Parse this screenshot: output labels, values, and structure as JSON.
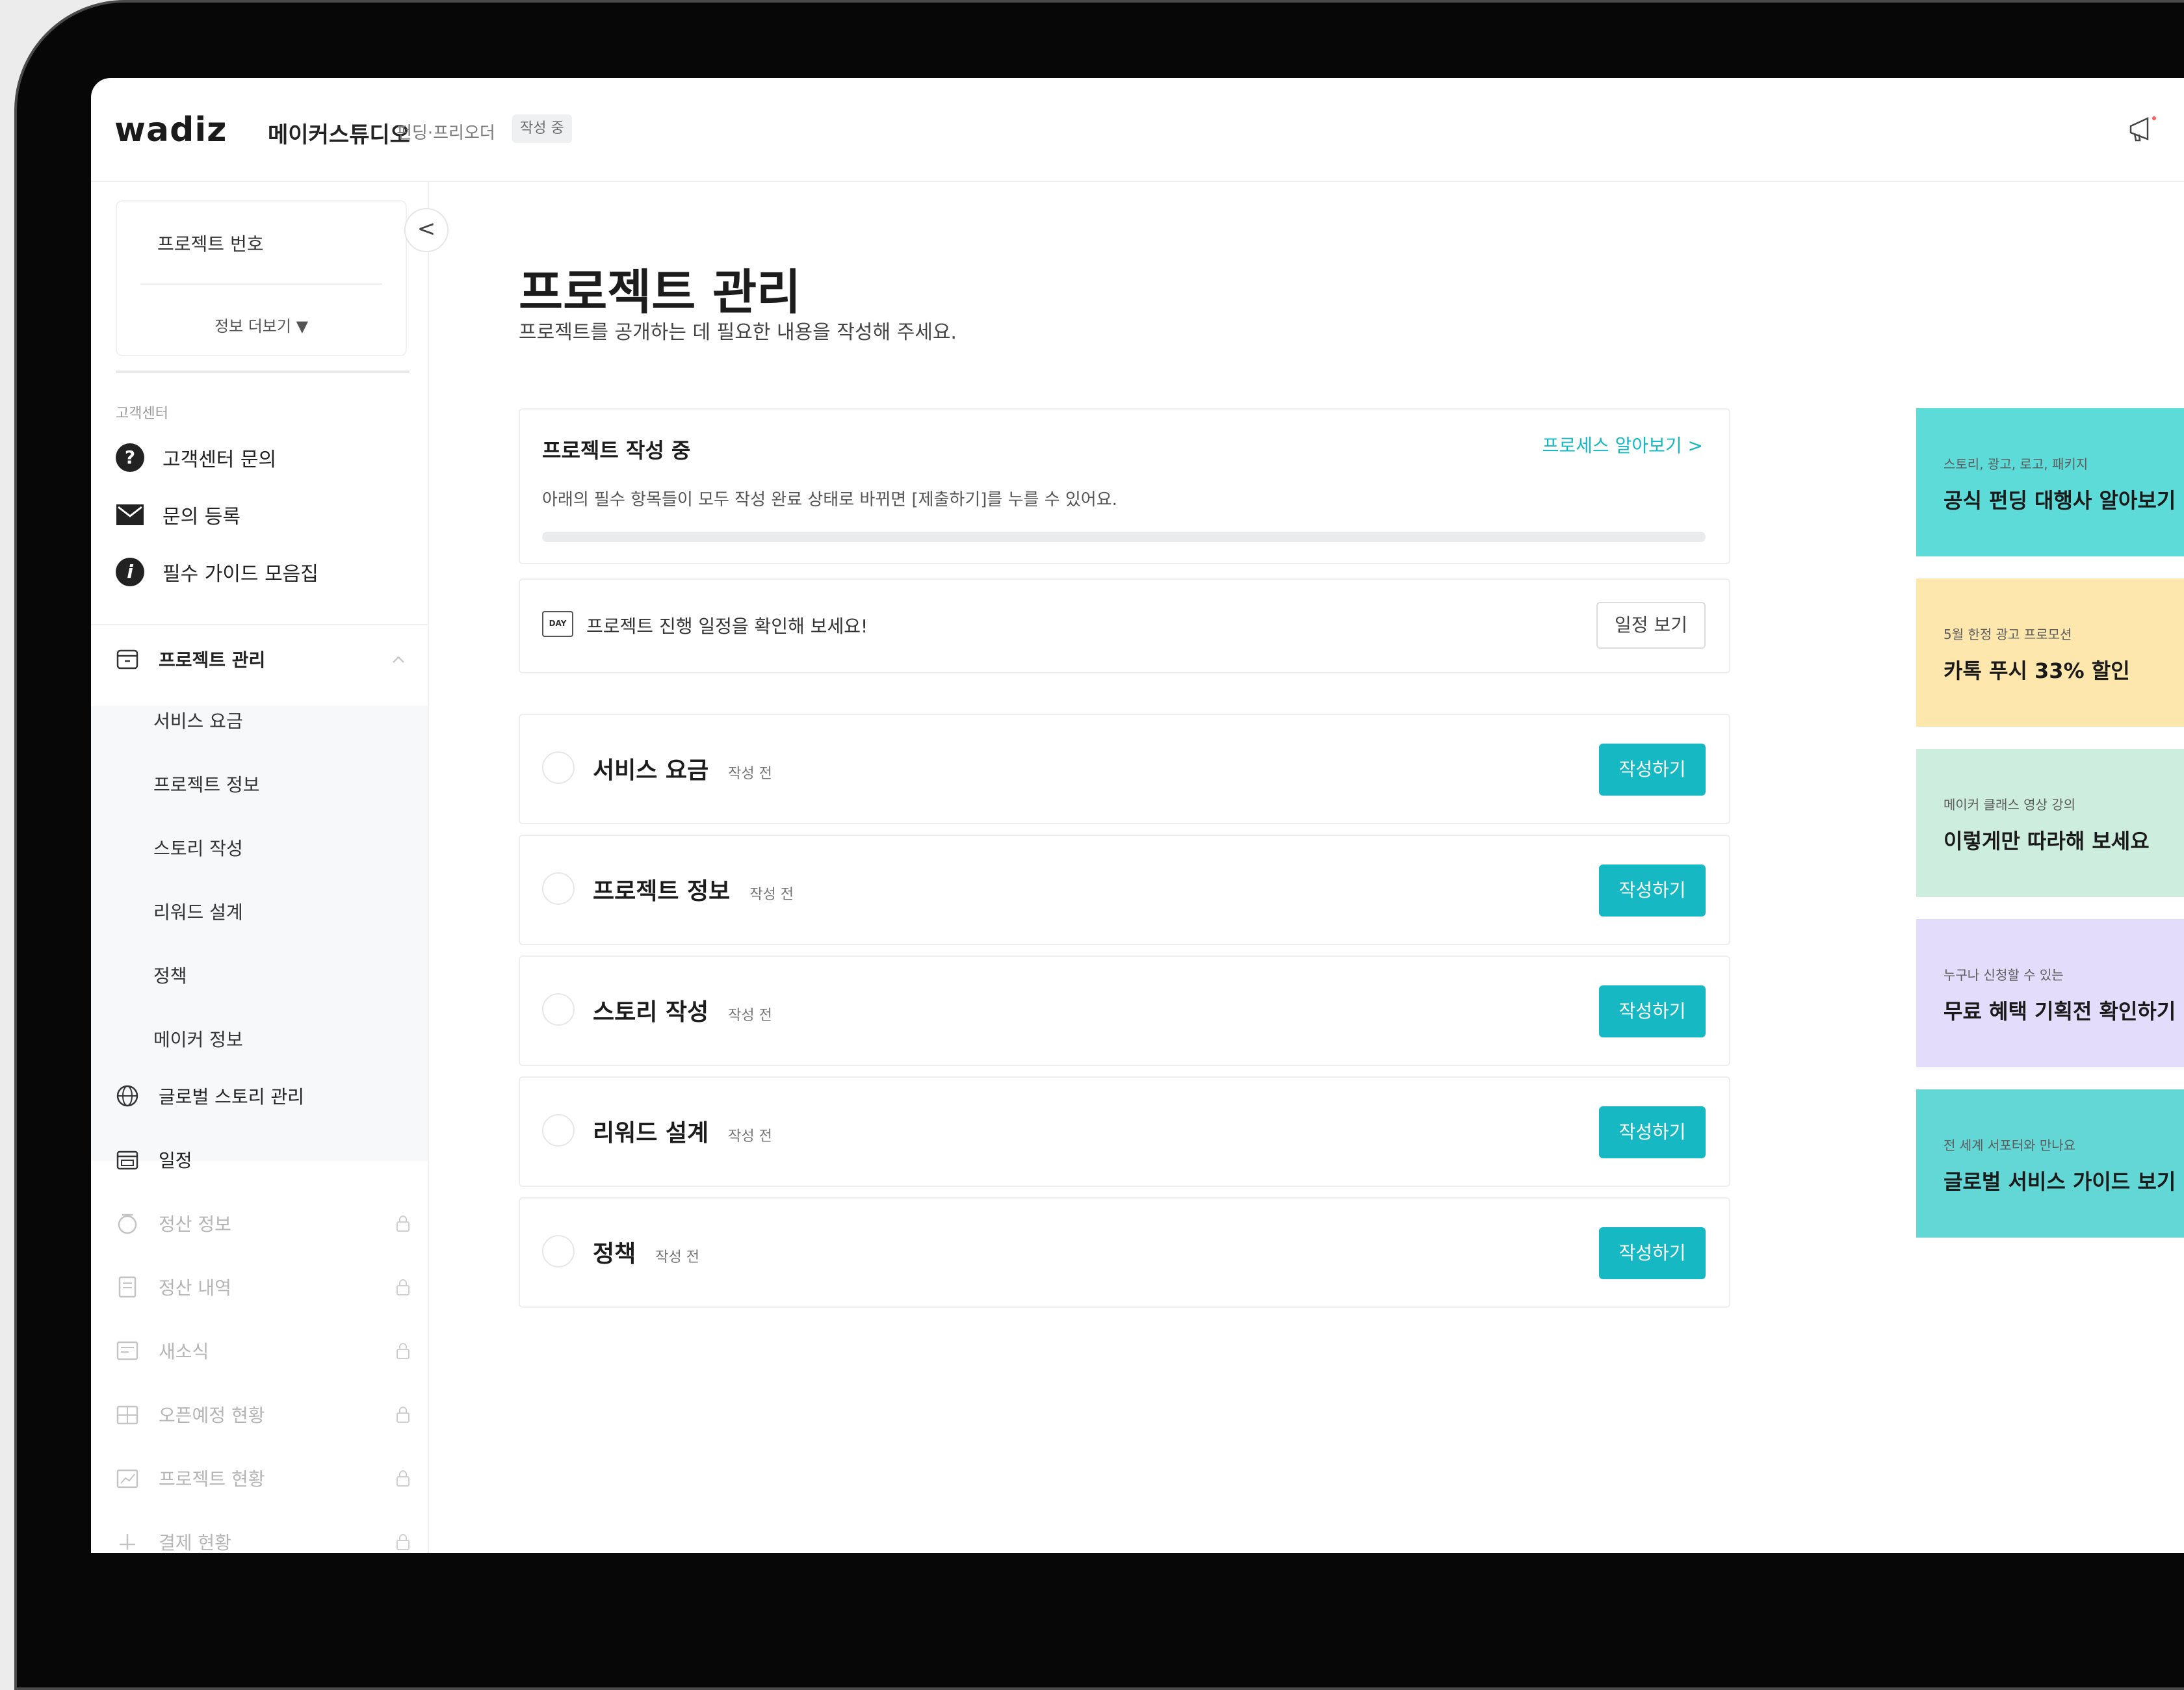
{
  "header": {
    "logo": "wadiz",
    "brand": "메이커스튜디오",
    "mode": "펀딩·프리오더",
    "status": "작성 중"
  },
  "sidebar": {
    "project_number_label": "프로젝트 번호",
    "more_info": "정보 더보기 ▼",
    "collapse": "<",
    "support_section_label": "고객센터",
    "support_items": [
      {
        "label": "고객센터 문의",
        "icon": "question-icon"
      },
      {
        "label": "문의 등록",
        "icon": "mail-icon"
      },
      {
        "label": "필수 가이드 모음집",
        "icon": "info-icon"
      }
    ],
    "project_manage": {
      "label": "프로젝트 관리",
      "icon": "calendar-icon"
    },
    "project_sub_items": [
      "서비스 요금",
      "프로젝트 정보",
      "스토리 작성",
      "리워드 설계",
      "정책",
      "메이커 정보"
    ],
    "menu_items": [
      {
        "label": "글로벌 스토리 관리",
        "icon": "globe-icon",
        "disabled": false
      },
      {
        "label": "일정",
        "icon": "day-calendar-icon",
        "disabled": false
      },
      {
        "label": "정산 정보",
        "icon": "coin-icon",
        "disabled": true
      },
      {
        "label": "정산 내역",
        "icon": "receipt-icon",
        "disabled": true
      },
      {
        "label": "새소식",
        "icon": "news-icon",
        "disabled": true
      },
      {
        "label": "오픈예정 현황",
        "icon": "building-icon",
        "disabled": true
      },
      {
        "label": "프로젝트 현황",
        "icon": "chart-icon",
        "disabled": true
      },
      {
        "label": "결제 현황",
        "icon": "plus-icon",
        "disabled": true
      }
    ]
  },
  "main": {
    "title": "프로젝트 관리",
    "subtitle": "프로젝트를 공개하는 데 필요한 내용을 작성해 주세요.",
    "progress": {
      "title": "프로젝트 작성 중",
      "link": "프로세스 알아보기 >",
      "description": "아래의 필수 항목들이 모두 작성 완료 상태로 바뀌면 [제출하기]를 누를 수 있어요.",
      "fraction": 0
    },
    "schedule": {
      "icon_text": "DAY",
      "text": "프로젝트 진행 일정을 확인해 보세요!",
      "button": "일정 보기"
    },
    "tasks": [
      {
        "name": "서비스 요금",
        "status": "작성 전",
        "button": "작성하기"
      },
      {
        "name": "프로젝트 정보",
        "status": "작성 전",
        "button": "작성하기"
      },
      {
        "name": "스토리 작성",
        "status": "작성 전",
        "button": "작성하기"
      },
      {
        "name": "리워드 설계",
        "status": "작성 전",
        "button": "작성하기"
      },
      {
        "name": "정책",
        "status": "작성 전",
        "button": "작성하기"
      }
    ]
  },
  "promos": [
    {
      "small": "스토리, 광고, 로고, 패키지",
      "big": "공식 펀딩 대행사 알아보기",
      "color": "#5ddbd8"
    },
    {
      "small": "5월 한정 광고 프로모션",
      "big": "카톡 푸시 33% 할인",
      "color": "#fde7ad"
    },
    {
      "small": "메이커 클래스 영상 강의",
      "big": "이렇게만 따라해 보세요",
      "color": "#cdeede"
    },
    {
      "small": "누구나 신청할 수 있는",
      "big": "무료 혜택 기획전 확인하기",
      "color": "#e3dcfb"
    },
    {
      "small": "전 세계 서포터와 만나요",
      "big": "글로벌 서비스 가이드 보기",
      "color": "#63d6d6"
    }
  ],
  "colors": {
    "accent": "#16b8c3"
  }
}
